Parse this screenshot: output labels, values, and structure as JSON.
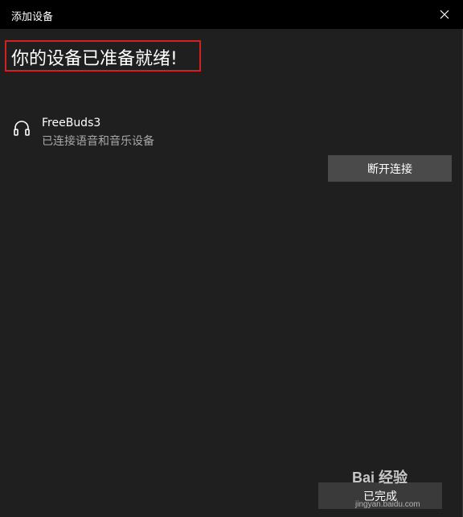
{
  "window": {
    "title": "添加设备"
  },
  "heading": "你的设备已准备就绪!",
  "device": {
    "name": "FreeBuds3",
    "status": "已连接语音和音乐设备",
    "icon": "headphones-icon"
  },
  "buttons": {
    "disconnect": "断开连接",
    "done": "已完成"
  },
  "watermark": {
    "text": "Bai 经验",
    "sub": "jingyan.baidu.com"
  },
  "colors": {
    "background": "#1f1f1f",
    "titlebar": "#000000",
    "highlight": "#d32020",
    "button": "#4a4a4a"
  }
}
